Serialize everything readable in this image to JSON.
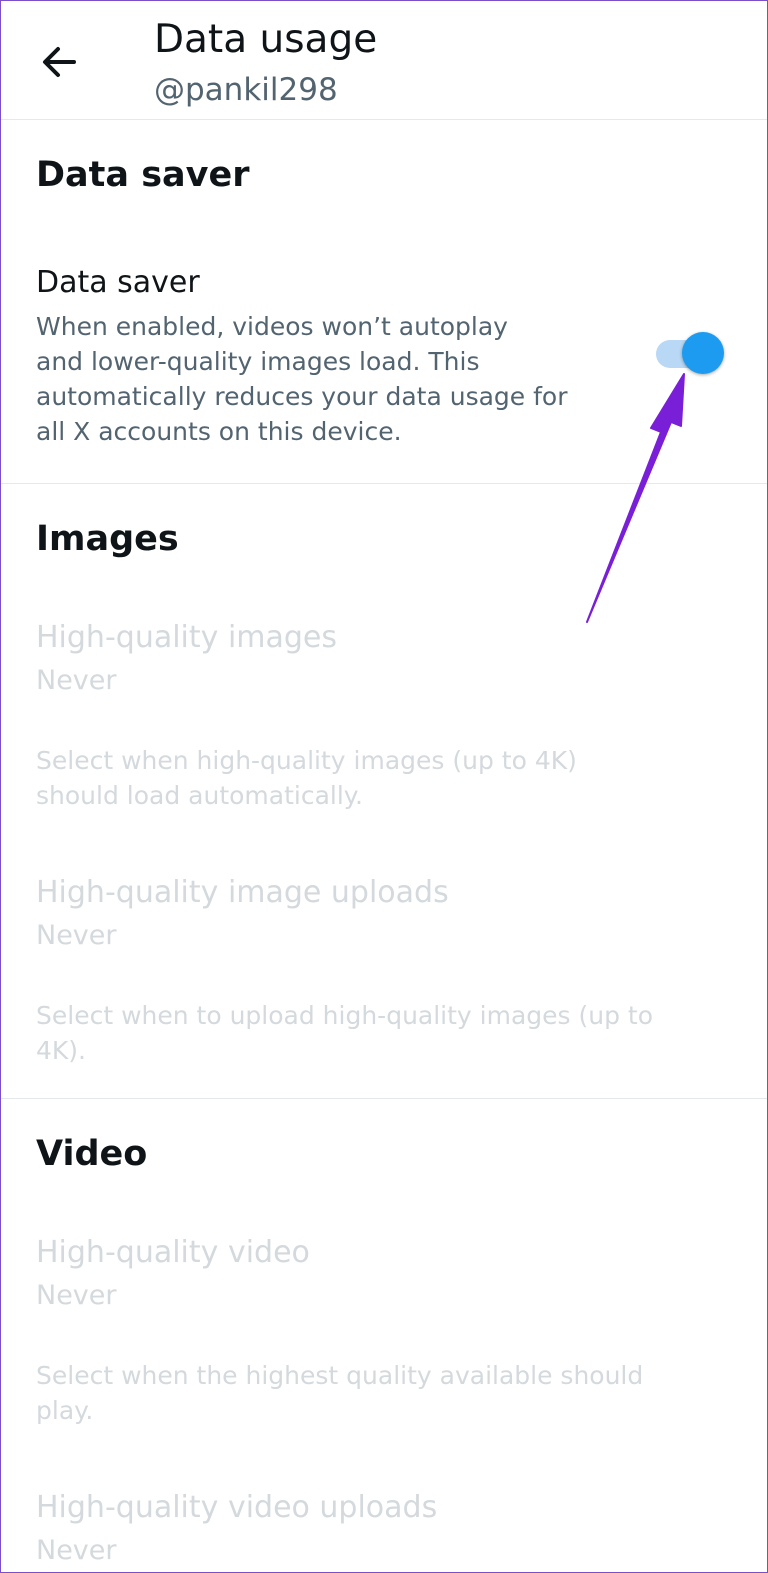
{
  "header": {
    "title": "Data usage",
    "subtitle": "@pankil298",
    "back_icon": "arrow-left-icon"
  },
  "data_saver_section": {
    "title": "Data saver",
    "item": {
      "title": "Data saver",
      "description_lines": [
        "When enabled, videos won’t autoplay",
        "and lower-quality images load. This",
        "automatically reduces your data usage for",
        "all X accounts on this device."
      ],
      "enabled": true
    }
  },
  "images_section": {
    "title": "Images",
    "items": [
      {
        "title": "High-quality images",
        "value": "Never",
        "description_lines": [
          "Select when high-quality images (up to 4K)",
          "should load automatically."
        ]
      },
      {
        "title": "High-quality image uploads",
        "value": "Never",
        "description_lines": [
          "Select when to upload high-quality images (up to",
          "4K)."
        ]
      }
    ]
  },
  "video_section": {
    "title": "Video",
    "items": [
      {
        "title": "High-quality video",
        "value": "Never",
        "description_lines": [
          "Select when the highest quality available should",
          "play."
        ]
      },
      {
        "title": "High-quality video uploads",
        "value": "Never"
      }
    ]
  },
  "colors": {
    "accent": "#1d9bf0",
    "toggle_track": "#b8d8f5",
    "annotation_arrow": "#7a1fd8",
    "disabled_text": "#d4d9dd",
    "secondary_text": "#536471"
  }
}
